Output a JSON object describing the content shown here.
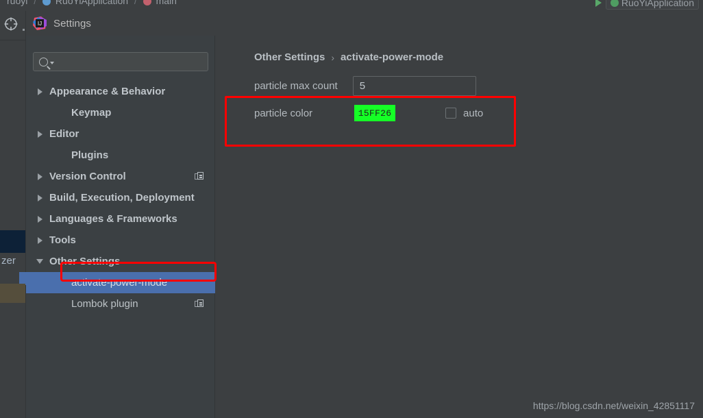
{
  "ide": {
    "breadcrumb": {
      "project": "ruoyi",
      "class": "RuoYiApplication",
      "method": "main",
      "separator": "/"
    },
    "run_config": {
      "name": "RuoYiApplication",
      "run_icon": "play-triangle-icon"
    },
    "left_rail": {
      "locate_icon": "crosshair-target-icon",
      "clipped_label": "zer"
    }
  },
  "dialog": {
    "title": "Settings",
    "app_icon": "intellij-idea-logo-icon",
    "search": {
      "placeholder": "",
      "value": "",
      "icon": "search-magnifier-icon",
      "caret_icon": "dropdown-caret-icon"
    },
    "tree": [
      {
        "label": "Appearance & Behavior",
        "expander": "collapsed",
        "bold": true,
        "indent": 0,
        "selected": false,
        "plugin_icon": false
      },
      {
        "label": "Keymap",
        "expander": "none",
        "bold": true,
        "indent": 1,
        "selected": false,
        "plugin_icon": false
      },
      {
        "label": "Editor",
        "expander": "collapsed",
        "bold": true,
        "indent": 0,
        "selected": false,
        "plugin_icon": false
      },
      {
        "label": "Plugins",
        "expander": "none",
        "bold": true,
        "indent": 1,
        "selected": false,
        "plugin_icon": false
      },
      {
        "label": "Version Control",
        "expander": "collapsed",
        "bold": true,
        "indent": 0,
        "selected": false,
        "plugin_icon": true
      },
      {
        "label": "Build, Execution, Deployment",
        "expander": "collapsed",
        "bold": true,
        "indent": 0,
        "selected": false,
        "plugin_icon": false
      },
      {
        "label": "Languages & Frameworks",
        "expander": "collapsed",
        "bold": true,
        "indent": 0,
        "selected": false,
        "plugin_icon": false
      },
      {
        "label": "Tools",
        "expander": "collapsed",
        "bold": true,
        "indent": 0,
        "selected": false,
        "plugin_icon": false
      },
      {
        "label": "Other Settings",
        "expander": "expanded",
        "bold": true,
        "indent": 0,
        "selected": false,
        "plugin_icon": false
      },
      {
        "label": "activate-power-mode",
        "expander": "none",
        "bold": false,
        "indent": 1,
        "selected": true,
        "plugin_icon": false
      },
      {
        "label": "Lombok plugin",
        "expander": "none",
        "bold": false,
        "indent": 1,
        "selected": false,
        "plugin_icon": true
      }
    ],
    "content": {
      "breadcrumb": {
        "parent": "Other Settings",
        "separator": "›",
        "current": "activate-power-mode"
      },
      "fields": {
        "max_count_label": "particle max count",
        "max_count_value": "5",
        "color_label": "particle color",
        "color_value": "15FF26",
        "color_hex": "#15FF26",
        "auto_label": "auto",
        "auto_checked": false
      }
    }
  },
  "annotations": {
    "highlight_color": "#FF0000",
    "boxes": [
      {
        "name": "particle-color-row-highlight"
      },
      {
        "name": "selected-tree-item-highlight"
      }
    ]
  },
  "watermark": "https://blog.csdn.net/weixin_42851117",
  "theme": {
    "panel_bg": "#3C3F41",
    "tree_bg": "#3B4043",
    "selection_blue": "#4A6FAD",
    "text": "#BDC3C7",
    "border": "#606466"
  }
}
